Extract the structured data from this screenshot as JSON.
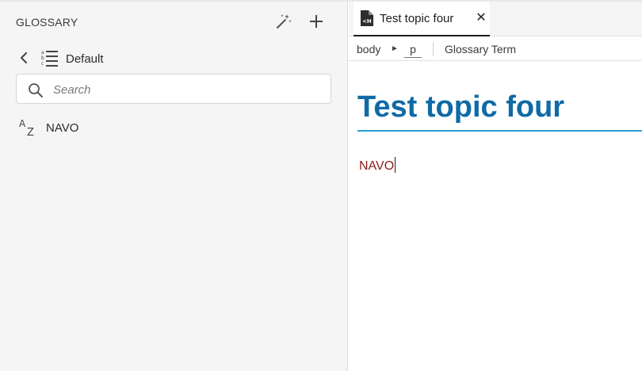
{
  "glossary_panel": {
    "title": "GLOSSARY",
    "group_label": "Default",
    "search_placeholder": "Search",
    "terms": [
      {
        "label": "NAVO"
      }
    ]
  },
  "editor": {
    "tab": {
      "label": "Test topic four",
      "close_glyph": "✕"
    },
    "breadcrumb": {
      "items": [
        "body",
        "p",
        "Glossary Term"
      ],
      "separator": "►"
    },
    "document": {
      "title": "Test topic four",
      "paragraph": "NAVO"
    }
  },
  "colors": {
    "panel_bg": "#f5f5f5",
    "title_blue": "#0f6aa6",
    "rule_blue": "#2b9fd8",
    "term_text": "#8b1a1a"
  }
}
